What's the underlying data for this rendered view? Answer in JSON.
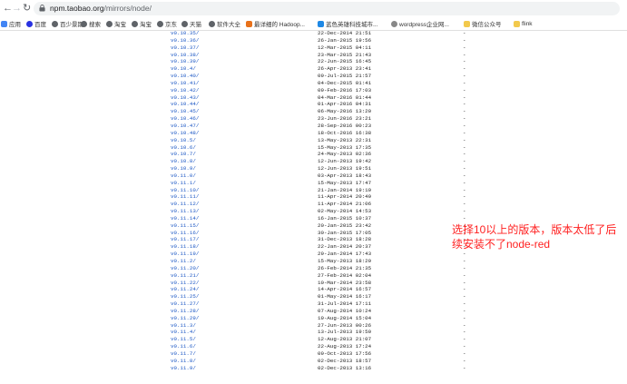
{
  "browser": {
    "url_host": "npm.taobao.org",
    "url_path": "/mirrors/node/",
    "back_icon": "arrow-left-icon",
    "forward_icon": "arrow-right-icon",
    "reload_icon": "reload-icon",
    "lock_icon": "lock-icon"
  },
  "bookmarks": [
    {
      "label": "应用",
      "icon": "apps-grid-icon",
      "color": "#4285f4"
    },
    {
      "label": "百度",
      "icon": "paw-icon",
      "color": "#2932e1"
    },
    {
      "label": "百少景期",
      "icon": "globe-icon",
      "color": "#5f6368"
    },
    {
      "label": "搜索",
      "icon": "globe-icon",
      "color": "#5f6368"
    },
    {
      "label": "淘宝",
      "icon": "globe-icon",
      "color": "#5f6368"
    },
    {
      "label": "淘宝",
      "icon": "globe-icon",
      "color": "#5f6368"
    },
    {
      "label": "京东",
      "icon": "globe-icon",
      "color": "#5f6368"
    },
    {
      "label": "天猫",
      "icon": "globe-icon",
      "color": "#5f6368"
    },
    {
      "label": "软件大全",
      "icon": "globe-icon",
      "color": "#5f6368"
    },
    {
      "label": "最详细的 Hadoop...",
      "icon": "blog-icon",
      "color": "#e8711a"
    },
    {
      "label": "蓝色英雄科技城市...",
      "icon": "bird-icon",
      "color": "#1e88e5"
    },
    {
      "label": "wordpress企业网...",
      "icon": "wordpress-icon",
      "color": "#888888"
    },
    {
      "label": "微信公众号",
      "icon": "folder-icon",
      "color": "#f2c94c"
    },
    {
      "label": "flink",
      "icon": "folder-icon",
      "color": "#f2c94c"
    }
  ],
  "listing": [
    {
      "name": "v0.10.35/",
      "date": "22-Dec-2014 21:51",
      "size": "-"
    },
    {
      "name": "v0.10.36/",
      "date": "26-Jan-2015 19:56",
      "size": "-"
    },
    {
      "name": "v0.10.37/",
      "date": "12-Mar-2015 04:11",
      "size": "-"
    },
    {
      "name": "v0.10.38/",
      "date": "23-Mar-2015 21:43",
      "size": "-"
    },
    {
      "name": "v0.10.39/",
      "date": "22-Jun-2015 16:45",
      "size": "-"
    },
    {
      "name": "v0.10.4/",
      "date": "26-Apr-2013 23:41",
      "size": "-"
    },
    {
      "name": "v0.10.40/",
      "date": "09-Jul-2015 21:57",
      "size": "-"
    },
    {
      "name": "v0.10.41/",
      "date": "04-Dec-2015 01:41",
      "size": "-"
    },
    {
      "name": "v0.10.42/",
      "date": "09-Feb-2016 17:03",
      "size": "-"
    },
    {
      "name": "v0.10.43/",
      "date": "04-Mar-2016 01:44",
      "size": "-"
    },
    {
      "name": "v0.10.44/",
      "date": "01-Apr-2016 04:31",
      "size": "-"
    },
    {
      "name": "v0.10.45/",
      "date": "06-May-2016 13:20",
      "size": "-"
    },
    {
      "name": "v0.10.46/",
      "date": "23-Jun-2016 23:21",
      "size": "-"
    },
    {
      "name": "v0.10.47/",
      "date": "28-Sep-2016 00:23",
      "size": "-"
    },
    {
      "name": "v0.10.48/",
      "date": "18-Oct-2016 16:38",
      "size": "-"
    },
    {
      "name": "v0.10.5/",
      "date": "13-May-2013 22:31",
      "size": "-"
    },
    {
      "name": "v0.10.6/",
      "date": "15-May-2013 17:35",
      "size": "-"
    },
    {
      "name": "v0.10.7/",
      "date": "24-May-2013 02:36",
      "size": "-"
    },
    {
      "name": "v0.10.8/",
      "date": "12-Jun-2013 19:42",
      "size": "-"
    },
    {
      "name": "v0.10.9/",
      "date": "12-Jun-2013 19:51",
      "size": "-"
    },
    {
      "name": "v0.11.0/",
      "date": "03-Apr-2013 18:43",
      "size": "-"
    },
    {
      "name": "v0.11.1/",
      "date": "15-May-2013 17:47",
      "size": "-"
    },
    {
      "name": "v0.11.10/",
      "date": "21-Jan-2014 19:19",
      "size": "-"
    },
    {
      "name": "v0.11.11/",
      "date": "11-Apr-2014 20:49",
      "size": "-"
    },
    {
      "name": "v0.11.12/",
      "date": "11-Apr-2014 21:06",
      "size": "-"
    },
    {
      "name": "v0.11.13/",
      "date": "02-May-2014 14:53",
      "size": "-"
    },
    {
      "name": "v0.11.14/",
      "date": "16-Jan-2015 10:37",
      "size": "-"
    },
    {
      "name": "v0.11.15/",
      "date": "20-Jan-2015 23:42",
      "size": "-"
    },
    {
      "name": "v0.11.16/",
      "date": "30-Jan-2015 17:05",
      "size": "-"
    },
    {
      "name": "v0.11.17/",
      "date": "31-Dec-2013 18:28",
      "size": "-"
    },
    {
      "name": "v0.11.18/",
      "date": "22-Jan-2014 20:37",
      "size": "-"
    },
    {
      "name": "v0.11.19/",
      "date": "29-Jan-2014 17:43",
      "size": "-"
    },
    {
      "name": "v0.11.2/",
      "date": "15-May-2013 18:29",
      "size": "-"
    },
    {
      "name": "v0.11.20/",
      "date": "26-Feb-2014 21:35",
      "size": "-"
    },
    {
      "name": "v0.11.21/",
      "date": "27-Feb-2014 02:04",
      "size": "-"
    },
    {
      "name": "v0.11.22/",
      "date": "10-Mar-2014 23:58",
      "size": "-"
    },
    {
      "name": "v0.11.24/",
      "date": "14-Apr-2014 16:57",
      "size": "-"
    },
    {
      "name": "v0.11.25/",
      "date": "01-May-2014 16:17",
      "size": "-"
    },
    {
      "name": "v0.11.27/",
      "date": "31-Jul-2014 17:11",
      "size": "-"
    },
    {
      "name": "v0.11.28/",
      "date": "07-Aug-2014 10:24",
      "size": "-"
    },
    {
      "name": "v0.11.29/",
      "date": "19-Aug-2014 15:04",
      "size": "-"
    },
    {
      "name": "v0.11.3/",
      "date": "27-Jun-2013 00:26",
      "size": "-"
    },
    {
      "name": "v0.11.4/",
      "date": "13-Jul-2013 19:50",
      "size": "-"
    },
    {
      "name": "v0.11.5/",
      "date": "12-Aug-2013 21:07",
      "size": "-"
    },
    {
      "name": "v0.11.6/",
      "date": "22-Aug-2013 17:24",
      "size": "-"
    },
    {
      "name": "v0.11.7/",
      "date": "09-Oct-2013 17:56",
      "size": "-"
    },
    {
      "name": "v0.11.8/",
      "date": "02-Dec-2013 18:57",
      "size": "-"
    },
    {
      "name": "v0.11.9/",
      "date": "02-Dec-2013 13:16",
      "size": "-"
    }
  ],
  "annotation": {
    "line1": "选择10以上的版本，版本太低了后",
    "line2": "续安装不了node-red",
    "color": "#ff1f1f"
  }
}
